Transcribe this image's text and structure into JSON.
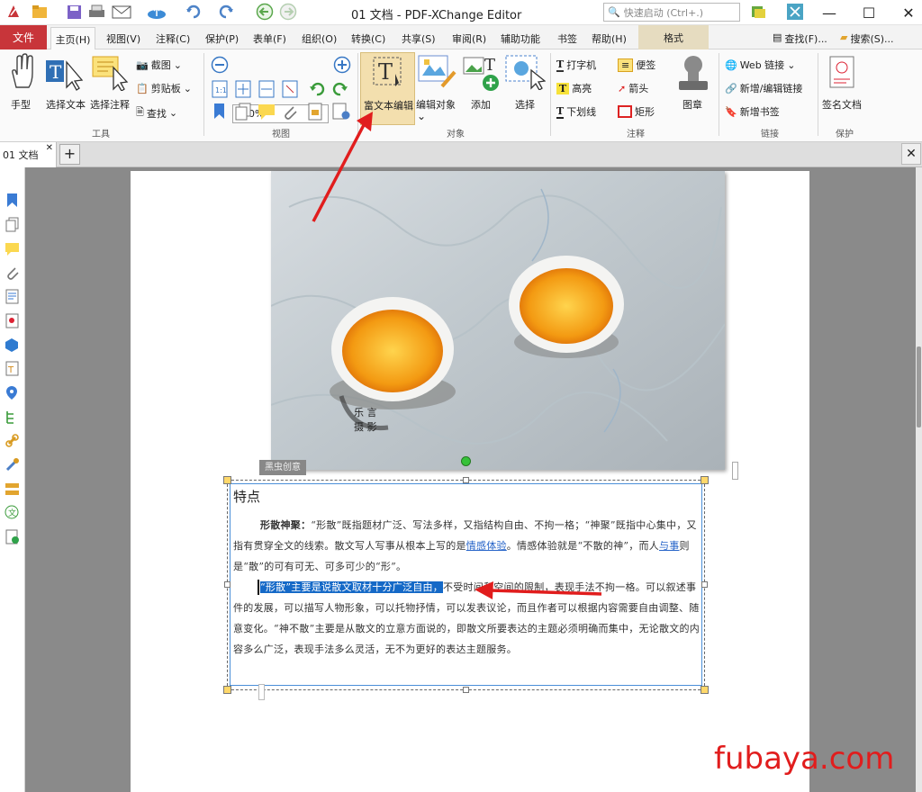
{
  "titlebar": {
    "title": "01 文档 - PDF-XChange Editor",
    "quick_search": "快速启动 (Ctrl+.)"
  },
  "menu": {
    "file": "文件",
    "home": "主页(H)",
    "items": [
      "视图(V)",
      "注释(C)",
      "保护(P)",
      "表单(F)",
      "组织(O)",
      "转换(C)",
      "共享(S)",
      "审阅(R)",
      "辅助功能",
      "书签",
      "帮助(H)"
    ],
    "format": "格式",
    "find": "查找(F)...",
    "search": "搜索(S)..."
  },
  "ribbon": {
    "tools": {
      "hand": "手型",
      "select_text": "选择文本",
      "select_comment": "选择注释",
      "snapshot": "截图",
      "clipboard": "剪贴板",
      "find": "查找",
      "group": "工具"
    },
    "view": {
      "zoom": "100%",
      "group": "视图"
    },
    "objects": {
      "rich_text": "富文本编辑",
      "edit_objects": "编辑对象",
      "add": "添加",
      "select": "选择",
      "group": "对象"
    },
    "comment": {
      "typewriter": "打字机",
      "note": "便签",
      "highlight": "高亮",
      "arrow": "箭头",
      "underline": "下划线",
      "rectangle": "矩形",
      "stamp": "图章",
      "group": "注释"
    },
    "links": {
      "web": "Web 链接",
      "add_edit": "新增/编辑链接",
      "add_bookmark": "新增书签",
      "group": "链接"
    },
    "protect": {
      "sign": "签名文档",
      "group": "保护"
    }
  },
  "doctab": {
    "name": "01 文档"
  },
  "document": {
    "photo_caption": "黑虫创意",
    "heading": "特点",
    "p1_bold": "形散神聚：",
    "p1_a": "“形散”既指题材广泛、写法多样，又指结构自由、不拘一格；“神聚”既指中心集中，又指有贯穿全文的线索。散文写人写事从根本上写的是",
    "p1_link1": "情感体验",
    "p1_b": "。情感体验就是“不散的神”，而人",
    "p1_link2": "与事",
    "p1_c": "则是“散”的可有可无、可多可少的“形”。",
    "p2_selected": "“形散”主要是说散文取材十分广泛自由，",
    "p2_a": "不受时间和空间的限制，表现手法不拘一格。可以叙述事件的发展，可以描写人物形象，可以托物抒情，可以发表议论，而且作者可以根据内容需要自由调整、随意变化。“神不散”主要是从散文的立意方面说的，即散文所要表达的主题必须明确而集中，无论散文的内容多么广泛，表现手法多么灵活，无不为更好的表达主题服务。"
  },
  "watermark": "fubaya.com",
  "colors": {
    "accent": "#c8353a",
    "selection": "#1569c7",
    "arrow": "#e11d1d"
  }
}
